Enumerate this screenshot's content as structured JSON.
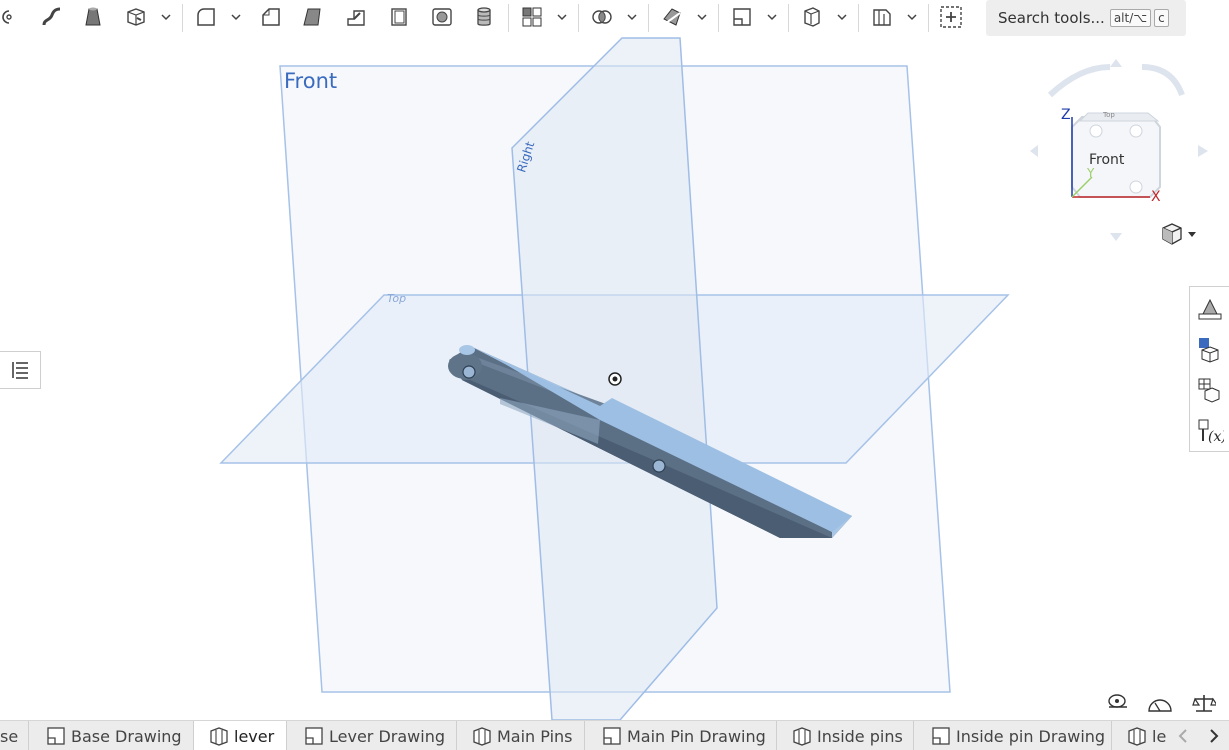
{
  "toolbar": {
    "icons": [
      "revolve-icon",
      "sweep-icon",
      "loft-icon",
      "thicken-icon",
      "fillet-icon",
      "chamfer-icon",
      "draft-icon",
      "rib-icon",
      "shell-icon",
      "hole-icon",
      "cylinder-icon",
      "pattern-icon",
      "boolean-icon",
      "split-icon",
      "plane-icon",
      "sheet-metal-icon",
      "frame-icon",
      "add-custom-feature-icon"
    ],
    "search_placeholder": "Search tools...",
    "shortcut_key1": "alt/⌥",
    "shortcut_key2": "c"
  },
  "viewport": {
    "plane_front_label": "Front",
    "plane_right_label": "Right",
    "plane_top_label": "Top"
  },
  "viewcube": {
    "face_front": "Front",
    "face_top": "Top",
    "axis_z": "Z",
    "axis_x": "X",
    "axis_y": "Y"
  },
  "tabs": [
    {
      "label": "se",
      "icon": "none",
      "active": false
    },
    {
      "label": "Base Drawing",
      "icon": "drawing-icon",
      "active": false
    },
    {
      "label": "lever",
      "icon": "part-studio-icon",
      "active": true
    },
    {
      "label": "Lever Drawing",
      "icon": "drawing-icon",
      "active": false
    },
    {
      "label": "Main Pins",
      "icon": "part-studio-icon",
      "active": false
    },
    {
      "label": "Main Pin Drawing",
      "icon": "drawing-icon",
      "active": false
    },
    {
      "label": "Inside pins",
      "icon": "part-studio-icon",
      "active": false
    },
    {
      "label": "Inside pin Drawing",
      "icon": "drawing-icon",
      "active": false
    },
    {
      "label": "le",
      "icon": "part-studio-icon",
      "active": false
    }
  ],
  "colors": {
    "plane_fill": "#e8eef6",
    "plane_stroke": "#9fbde6",
    "part_light": "#a9c7e6",
    "part_dark": "#55697e",
    "accent_blue": "#3a6bbf"
  }
}
